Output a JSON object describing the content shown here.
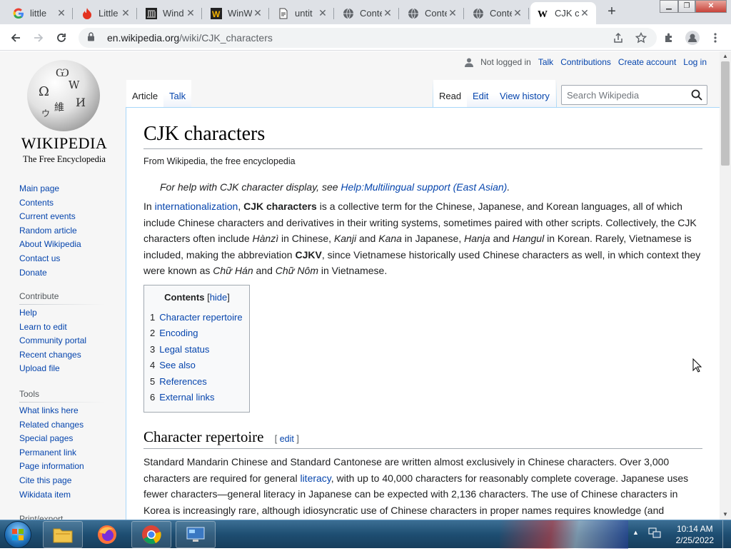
{
  "browser": {
    "tabs": [
      {
        "title": "little",
        "icon": "google-icon"
      },
      {
        "title": "Little",
        "icon": "flame-icon"
      },
      {
        "title": "Wind",
        "icon": "museum-icon"
      },
      {
        "title": "WinW",
        "icon": "w-icon"
      },
      {
        "title": "untit",
        "icon": "doc-icon"
      },
      {
        "title": "Conte",
        "icon": "globe-icon"
      },
      {
        "title": "Conte",
        "icon": "globe-icon"
      },
      {
        "title": "Conte",
        "icon": "globe-icon"
      },
      {
        "title": "CJK c",
        "icon": "wikipedia-icon",
        "active": true
      }
    ],
    "new_tab": "+",
    "url_host": "en.wikipedia.org",
    "url_path": "/wiki/CJK_characters"
  },
  "logo": {
    "wordmark": "WIKIPEDIA",
    "tagline": "The Free Encyclopedia"
  },
  "sidebar": {
    "main": [
      "Main page",
      "Contents",
      "Current events",
      "Random article",
      "About Wikipedia",
      "Contact us",
      "Donate"
    ],
    "contribute_title": "Contribute",
    "contribute": [
      "Help",
      "Learn to edit",
      "Community portal",
      "Recent changes",
      "Upload file"
    ],
    "tools_title": "Tools",
    "tools": [
      "What links here",
      "Related changes",
      "Special pages",
      "Permanent link",
      "Page information",
      "Cite this page",
      "Wikidata item"
    ],
    "print_title": "Print/export"
  },
  "user": {
    "not_logged_in": "Not logged in",
    "talk": "Talk",
    "contributions": "Contributions",
    "create_account": "Create account",
    "log_in": "Log in"
  },
  "tabs": {
    "article": "Article",
    "talk": "Talk",
    "read": "Read",
    "edit": "Edit",
    "history": "View history"
  },
  "search": {
    "placeholder": "Search Wikipedia"
  },
  "article": {
    "title": "CJK characters",
    "from": "From Wikipedia, the free encyclopedia",
    "hatnote_prefix": "For help with CJK character display, see ",
    "hatnote_link": "Help:Multilingual support (East Asian)",
    "hatnote_suffix": ".",
    "lede": {
      "t1": "In ",
      "l1": "internationalization",
      "t2": ", ",
      "b1": "CJK characters",
      "t3": " is a collective term for the Chinese, Japanese, and Korean languages, all of which include Chinese characters and derivatives in their writing systems, sometimes paired with other scripts. Collectively, the CJK characters often include ",
      "i1": "Hànzì",
      "t4": " in Chinese, ",
      "i2": "Kanji",
      "t5": " and ",
      "i3": "Kana",
      "t6": " in Japanese, ",
      "i4": "Hanja",
      "t7": " and ",
      "i5": "Hangul",
      "t8": " in Korean. Rarely, Vietnamese is included, making the abbreviation ",
      "b2": "CJKV",
      "t9": ", since Vietnamese historically used Chinese characters as well, in which context they were known as ",
      "i6": "Chữ Hán",
      "t10": " and ",
      "i7": "Chữ Nôm",
      "t11": " in Vietnamese."
    },
    "toc": {
      "title": "Contents",
      "hide": "hide",
      "items": [
        {
          "num": "1",
          "label": "Character repertoire"
        },
        {
          "num": "2",
          "label": "Encoding"
        },
        {
          "num": "3",
          "label": "Legal status"
        },
        {
          "num": "4",
          "label": "See also"
        },
        {
          "num": "5",
          "label": "References"
        },
        {
          "num": "6",
          "label": "External links"
        }
      ]
    },
    "section1": {
      "heading": "Character repertoire",
      "edit": "edit",
      "t1": "Standard Mandarin Chinese and Standard Cantonese are written almost exclusively in Chinese characters. Over 3,000 characters are required for general ",
      "l1": "literacy",
      "t2": ", with up to 40,000 characters for reasonably complete coverage. Japanese uses fewer characters—general literacy in Japanese can be expected with 2,136 characters. The use of Chinese characters in Korea is increasingly rare, although idiosyncratic use of Chinese characters in proper names requires knowledge (and"
    }
  },
  "taskbar": {
    "time": "10:14 AM",
    "date": "2/25/2022"
  },
  "colors": {
    "link": "#0645ad",
    "taskbar": "#1e4e72"
  }
}
